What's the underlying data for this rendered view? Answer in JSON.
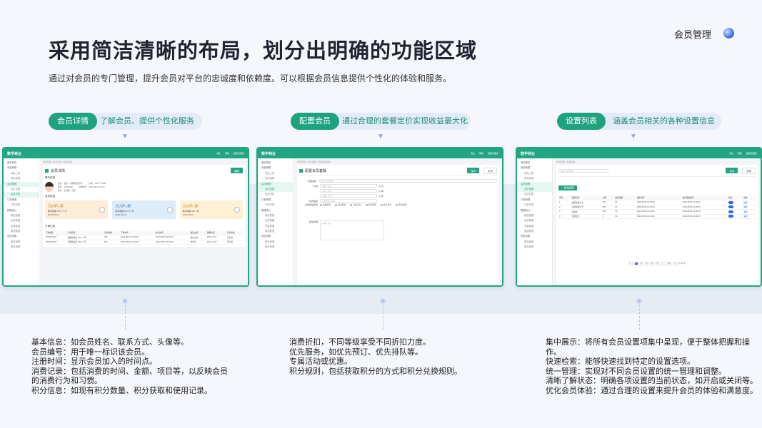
{
  "header": {
    "title": "采用简洁清晰的布局，划分出明确的功能区域",
    "subtitle": "通过对会员的专门管理，提升会员对平台的忠诚度和依赖度。可以根据会员信息提供个性化的体验和服务。",
    "brand": "会员管理"
  },
  "sections": [
    {
      "tag": "会员详情",
      "tagline": "了解会员、提供个性化服务",
      "desc": [
        "基本信息：如会员姓名、联系方式、头像等。",
        "会员编号：用于唯一标识该会员。",
        "注册时间：显示会员加入的时间点。",
        "消费记录：包括消费的时间、金额、项目等，以反映会员的消费行为和习惯。",
        "积分信息：如现有积分数量、积分获取和使用记录。"
      ]
    },
    {
      "tag": "配置会员",
      "tagline": "通过合理的套餐定价实现收益最大化",
      "desc": [
        "消费折扣，不同等级享受不同折扣力度。",
        "优先服务，如优先预订、优先排队等。",
        "专属活动或优惠。",
        "积分规则，包括获取积分的方式和积分兑换规则。"
      ]
    },
    {
      "tag": "设置列表",
      "tagline": "涵盖会员相关的各种设置信息",
      "desc": [
        "集中展示：将所有会员设置项集中呈现，便于整体把握和操作。",
        "快速检索：能够快速找到特定的设置选项。",
        "统一管理：实现对不同会员设置的统一管理和调整。",
        "清晰了解状态：明确各项设置的当前状态，如开启或关闭等。",
        "优化会员体验：通过合理的设置来提升会员的体验和满意度。"
      ]
    }
  ],
  "app": {
    "logo": "数字商业",
    "topbar": [
      "消息",
      "帮助",
      "超级管理员"
    ],
    "sidebar": [
      "首页概览",
      "商品管理",
      "商品上架",
      "库存管理",
      "会员管理",
      "会员设置",
      "会员列表",
      "订单管理",
      "订单列表",
      "数据统计",
      "销售数据",
      "会员数据",
      "流量数据",
      "渠道数据",
      "系统设置",
      "账号管理",
      "角色管理"
    ],
    "s1": {
      "breadcrumb": "会员管理 / 会员列表 / 会员详情",
      "page_title": "会员详情",
      "btn": "编辑",
      "basic": "基本信息",
      "name_label": "姓名",
      "name": "张某（流程测试账号）",
      "phone_label": "手机",
      "phone": "186****5488",
      "id_label": "编号",
      "id": "20230810",
      "reg_label": "注册时间",
      "reg": "2023-08-10 14:00",
      "tag_label": "标签",
      "tag": "高消费 · 活跃",
      "points_title": "会员权益",
      "cards": [
        {
          "n": "SVIP-月",
          "d": "畅享数据 VIP·1个月",
          "t": "2023-09-10"
        },
        {
          "n": "SVIP-季",
          "d": "畅享数据 VIP·3个月",
          "t": "2023-11-10"
        },
        {
          "n": "SVIP-年",
          "d": "畅享数据 VIP·1年",
          "t": "2024-08-10"
        }
      ],
      "orders_title": "订单记录",
      "cols": [
        "订单编号",
        "订单名称",
        "订单金额",
        "下单时间",
        "支付时间",
        "会员方式",
        "到期时间",
        "订单状态"
      ],
      "rows": [
        [
          "2023070203",
          "超级版会员 VIP·1个月",
          "399",
          "2023-08-06 14:00:00",
          "2023-08-06 14:00:00",
          "微信支付",
          "2023-11-04",
          "已完成"
        ],
        [
          "2023070203",
          "高级版会员 VIP·1个月",
          "399",
          "2023-08-06 14:00:00",
          "2023-08-06 14:00:00",
          "支付宝",
          "2023-11-04",
          "已完成"
        ]
      ]
    },
    "s2": {
      "breadcrumb": "会员管理 / 会员设置 / 配置会员套餐",
      "page_title": "配置会员套餐",
      "ok": "保存",
      "cancel": "取消",
      "fields": [
        {
          "l": "* 套餐名称",
          "v": "请输入套餐名称"
        },
        {
          "l": "* 价格",
          "v": "请输入价格",
          "u": "元/月"
        },
        {
          "l": "",
          "v": "请输入价格",
          "u": "元/季"
        },
        {
          "l": "",
          "v": "请输入价格",
          "u": "元/年"
        },
        {
          "l": "* 会员等级",
          "v": "请选择会员等级"
        }
      ],
      "rights_label": "会员权益配置",
      "rights": [
        "消费折扣",
        "优先服务",
        "专属活动",
        "积分规则",
        "生日礼包",
        "专属客服"
      ],
      "remark_label": "备注说明",
      "remark": "请输入备注"
    },
    "s3": {
      "breadcrumb": "会员管理 / 会员设置",
      "search": "请输入设置名称",
      "btn_q": "查询",
      "btn_r": "重置",
      "btn_add": "+ 新增设置",
      "cols": [
        "序号",
        "设置名称",
        "价格",
        "会员天数",
        "创建时间",
        "最后修改时间",
        "状态",
        "操作"
      ],
      "rows": [
        [
          "1",
          "超级版会员卡",
          "399",
          "30",
          "2023-08-06 14:00:00",
          "2023-08-06 14:00:00",
          "编辑"
        ],
        [
          "2",
          "高级版会员卡",
          "299",
          "30",
          "2023-08-06 14:00:00",
          "2023-08-06 14:00:00",
          "编辑"
        ],
        [
          "3",
          "基础卡",
          "199",
          "30",
          "2023-08-06 14:00:00",
          "2023-08-06 14:00:00",
          "编辑"
        ],
        [
          "4",
          "普通会员",
          "0",
          "30",
          "2023-08-06 14:00:00",
          "2023-08-06 14:00:00",
          "编辑"
        ]
      ],
      "pager": [
        "<",
        "1",
        "2",
        "3",
        "4",
        "5",
        "...",
        "10",
        ">",
        "共 40 条"
      ]
    }
  }
}
